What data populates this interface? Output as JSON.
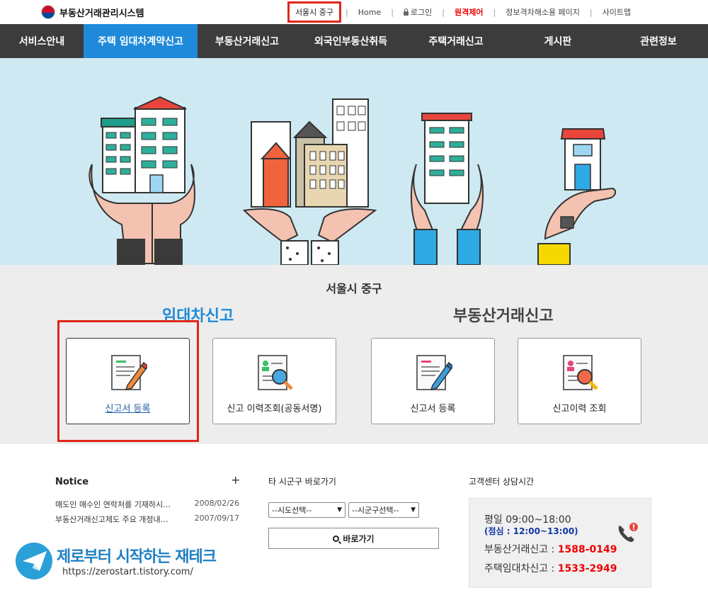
{
  "header": {
    "logo_text": "부동산거래관리시스템",
    "region": "서울시 중구",
    "home": "Home",
    "login": "로그인",
    "remote": "원격제어",
    "accessibility": "정보격차해소용 페이지",
    "sitemap": "사이트맵"
  },
  "nav": {
    "items": [
      {
        "label": "서비스안내"
      },
      {
        "label": "주택 임대차계약신고"
      },
      {
        "label": "부동산거래신고"
      },
      {
        "label": "외국인부동산취득"
      },
      {
        "label": "주택거래신고"
      },
      {
        "label": "게시판"
      },
      {
        "label": "관련정보"
      }
    ],
    "active_index": 1
  },
  "select": {
    "region_title": "서울시 중구",
    "lease_title": "임대차신고",
    "trade_title": "부동산거래신고",
    "cards": [
      {
        "label": "신고서 등록"
      },
      {
        "label": "신고 이력조회(공동서명)"
      },
      {
        "label": "신고서 등록"
      },
      {
        "label": "신고이력 조회"
      }
    ]
  },
  "notice": {
    "title": "Notice",
    "more": "+",
    "items": [
      {
        "title": "매도인 매수인 연락처를 기재하시…",
        "date": "2008/02/26"
      },
      {
        "title": "부동산거래신고제도 주요 개정내…",
        "date": "2007/09/17"
      }
    ]
  },
  "quick": {
    "title": "타 시군구 바로가기",
    "sido_selected": "--시도선택--",
    "sigungu_selected": "--시군구선택--",
    "go_label": "바로가기"
  },
  "cs": {
    "title": "고객센터 상담시간",
    "hours": "평일 09:00~18:00",
    "lunch": "(점심 : 12:00~13:00)",
    "trade_label": "부동산거래신고 : ",
    "trade_number": "1588-0149",
    "lease_label": "주택임대차신고 : ",
    "lease_number": "1533-2949"
  },
  "watermark": {
    "text": "제로부터 시작하는 재테크",
    "url": "https://zerostart.tistory.com/"
  },
  "colors": {
    "nav_bg": "#3c3c3c",
    "nav_active": "#1f8ad9",
    "hero_bg": "#cfe9f2",
    "highlight": "#e0261a"
  }
}
